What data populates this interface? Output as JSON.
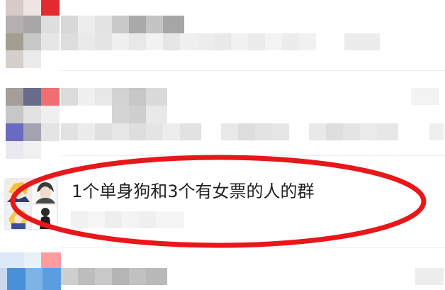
{
  "chat_list": {
    "highlighted_chat": {
      "title": "1个单身狗和3个有女票的人的群"
    }
  },
  "colors": {
    "annotation_stroke": "#e8171a",
    "title_text": "#222222",
    "pixelated_tones": [
      "#cfcccc",
      "#9e9e9e",
      "#e23a3c",
      "#6a6aa0",
      "#4a8fd8",
      "#fe9ca0"
    ]
  }
}
